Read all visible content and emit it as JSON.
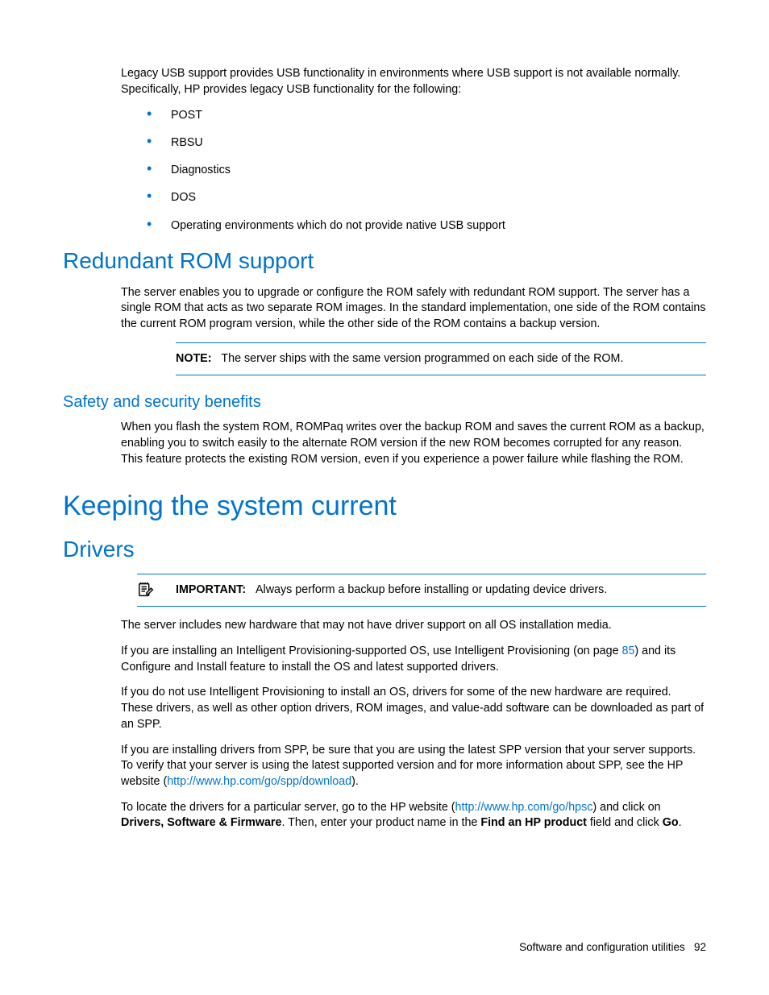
{
  "intro": {
    "p1": "Legacy USB support provides USB functionality in environments where USB support is not available normally. Specifically, HP provides legacy USB functionality for the following:",
    "items": [
      "POST",
      "RBSU",
      "Diagnostics",
      "DOS",
      "Operating environments which do not provide native USB support"
    ]
  },
  "redundant": {
    "heading": "Redundant ROM support",
    "p1": "The server enables you to upgrade or configure the ROM safely with redundant ROM support. The server has a single ROM that acts as two separate ROM images. In the standard implementation, one side of the ROM contains the current ROM program version, while the other side of the ROM contains a backup version.",
    "note_label": "NOTE:",
    "note_text": "The server ships with the same version programmed on each side of the ROM."
  },
  "safety": {
    "heading": "Safety and security benefits",
    "p1": "When you flash the system ROM, ROMPaq writes over the backup ROM and saves the current ROM as a backup, enabling you to switch easily to the alternate ROM version if the new ROM becomes corrupted for any reason. This feature protects the existing ROM version, even if you experience a power failure while flashing the ROM."
  },
  "keeping": {
    "heading": "Keeping the system current"
  },
  "drivers": {
    "heading": "Drivers",
    "important_label": "IMPORTANT:",
    "important_text": "Always perform a backup before installing or updating device drivers.",
    "p1": "The server includes new hardware that may not have driver support on all OS installation media.",
    "p2a": "If you are installing an Intelligent Provisioning-supported OS, use Intelligent Provisioning (on page ",
    "p2_page": "85",
    "p2b": ") and its Configure and Install feature to install the OS and latest supported drivers.",
    "p3": "If you do not use Intelligent Provisioning to install an OS, drivers for some of the new hardware are required. These drivers, as well as other option drivers, ROM images, and value-add software can be downloaded as part of an SPP.",
    "p4a": "If you are installing drivers from SPP, be sure that you are using the latest SPP version that your server supports. To verify that your server is using the latest supported version and for more information about SPP, see the HP website (",
    "p4_link": "http://www.hp.com/go/spp/download",
    "p4b": ").",
    "p5a": "To locate the drivers for a particular server, go to the HP website (",
    "p5_link": "http://www.hp.com/go/hpsc",
    "p5b": ") and click on ",
    "p5_bold1": "Drivers, Software & Firmware",
    "p5c": ". Then, enter your product name in the ",
    "p5_bold2": "Find an HP product",
    "p5d": " field and click ",
    "p5_bold3": "Go",
    "p5e": "."
  },
  "footer": {
    "section": "Software and configuration utilities",
    "page": "92"
  }
}
